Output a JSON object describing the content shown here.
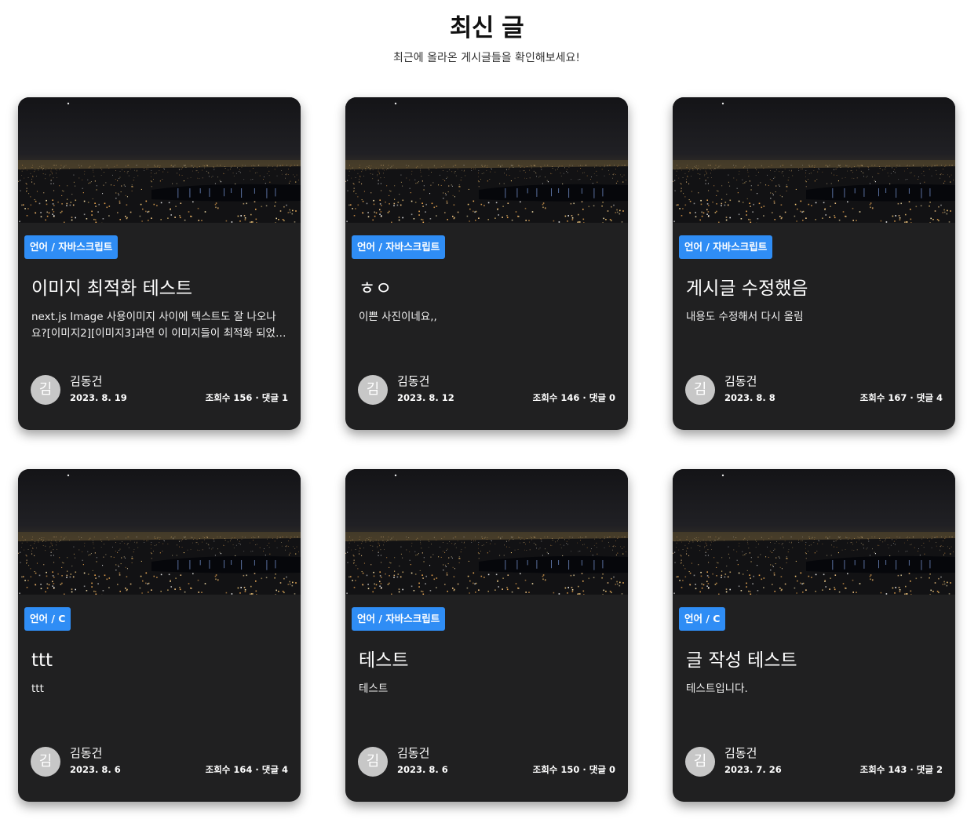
{
  "header": {
    "title": "최신 글",
    "subtitle": "최근에 올라온 게시글들을 확인해보세요!"
  },
  "labels": {
    "views": "조회수",
    "comments": "댓글",
    "separator": "·"
  },
  "posts": [
    {
      "category": "언어 / 자바스크립트",
      "title": "이미지 최적화 테스트",
      "excerpt": "next.js Image 사용이미지 사이에 텍스트도 잘 나오나요?[이미지2][이미지3]과연 이 이미지들이 최적화 되었을까요",
      "author": "김동건",
      "avatar_initial": "김",
      "date": "2023. 8. 19",
      "views": 156,
      "comments": 1,
      "image": "night-city-photo"
    },
    {
      "category": "언어 / 자바스크립트",
      "title": "ㅎㅇ",
      "excerpt": "이쁜 사진이네요,,",
      "author": "김동건",
      "avatar_initial": "김",
      "date": "2023. 8. 12",
      "views": 146,
      "comments": 0,
      "image": "night-city-photo"
    },
    {
      "category": "언어 / 자바스크립트",
      "title": "게시글 수정했음",
      "excerpt": "내용도 수정해서 다시 올림",
      "author": "김동건",
      "avatar_initial": "김",
      "date": "2023. 8. 8",
      "views": 167,
      "comments": 4,
      "image": "night-city-photo"
    },
    {
      "category": "언어 / C",
      "title": "ttt",
      "excerpt": "ttt",
      "author": "김동건",
      "avatar_initial": "김",
      "date": "2023. 8. 6",
      "views": 164,
      "comments": 4,
      "image": "night-city-photo"
    },
    {
      "category": "언어 / 자바스크립트",
      "title": "테스트",
      "excerpt": "테스트",
      "author": "김동건",
      "avatar_initial": "김",
      "date": "2023. 8. 6",
      "views": 150,
      "comments": 0,
      "image": "night-city-photo"
    },
    {
      "category": "언어 / C",
      "title": "글 작성 테스트",
      "excerpt": "테스트입니다.",
      "author": "김동건",
      "avatar_initial": "김",
      "date": "2023. 7. 26",
      "views": 143,
      "comments": 2,
      "image": "night-city-photo"
    }
  ],
  "colors": {
    "card_background": "#202021",
    "category_badge": "#2f8df5",
    "avatar_background": "#c7c7c7",
    "page_background": "#ffffff"
  }
}
